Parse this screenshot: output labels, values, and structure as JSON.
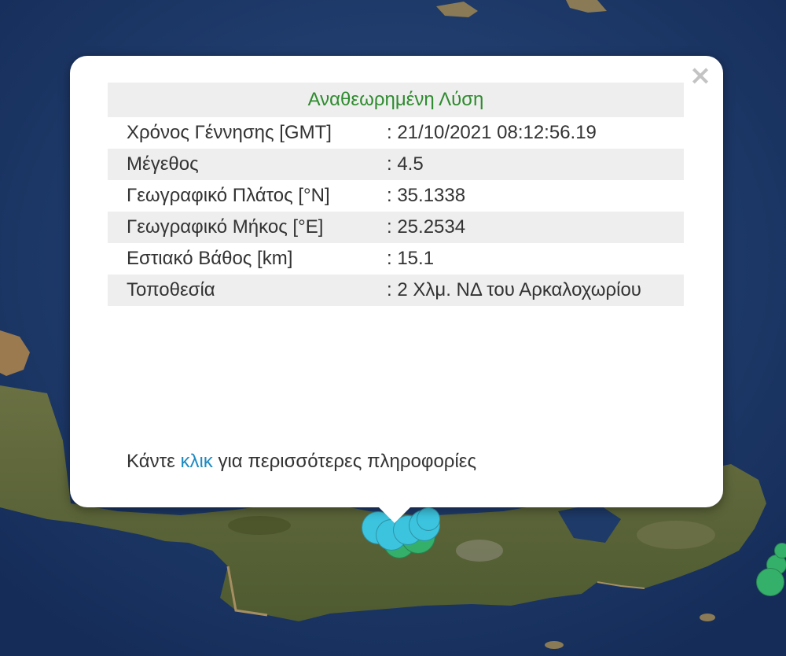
{
  "popup": {
    "title": "Αναθεωρημένη Λύση",
    "title_color": "#2e8b2e",
    "close_symbol": "×",
    "rows": [
      {
        "label": "Χρόνος Γέννησης [GMT]",
        "value": ": 21/10/2021 08:12:56.19"
      },
      {
        "label": "Μέγεθος",
        "value": ": 4.5"
      },
      {
        "label": "Γεωγραφικό Πλάτος [°N]",
        "value": ": 35.1338"
      },
      {
        "label": "Γεωγραφικό Μήκος [°E]",
        "value": ": 25.2534"
      },
      {
        "label": "Εστιακό Βάθος [km]",
        "value": ": 15.1"
      },
      {
        "label": "Τοποθεσία",
        "value": ": 2 Χλμ. ΝΔ του Αρκαλοχωρίου"
      }
    ],
    "more_prefix": "Κάντε",
    "more_link": "κλικ",
    "more_suffix": "για περισσότερες πληροφορίες",
    "link_color": "#1e8bc3"
  },
  "map": {
    "sea_color": "#1e3a68",
    "land_color": "#5c6a3a",
    "marker_colors": {
      "cyan": "#3cc4df",
      "green": "#35b06a"
    }
  }
}
